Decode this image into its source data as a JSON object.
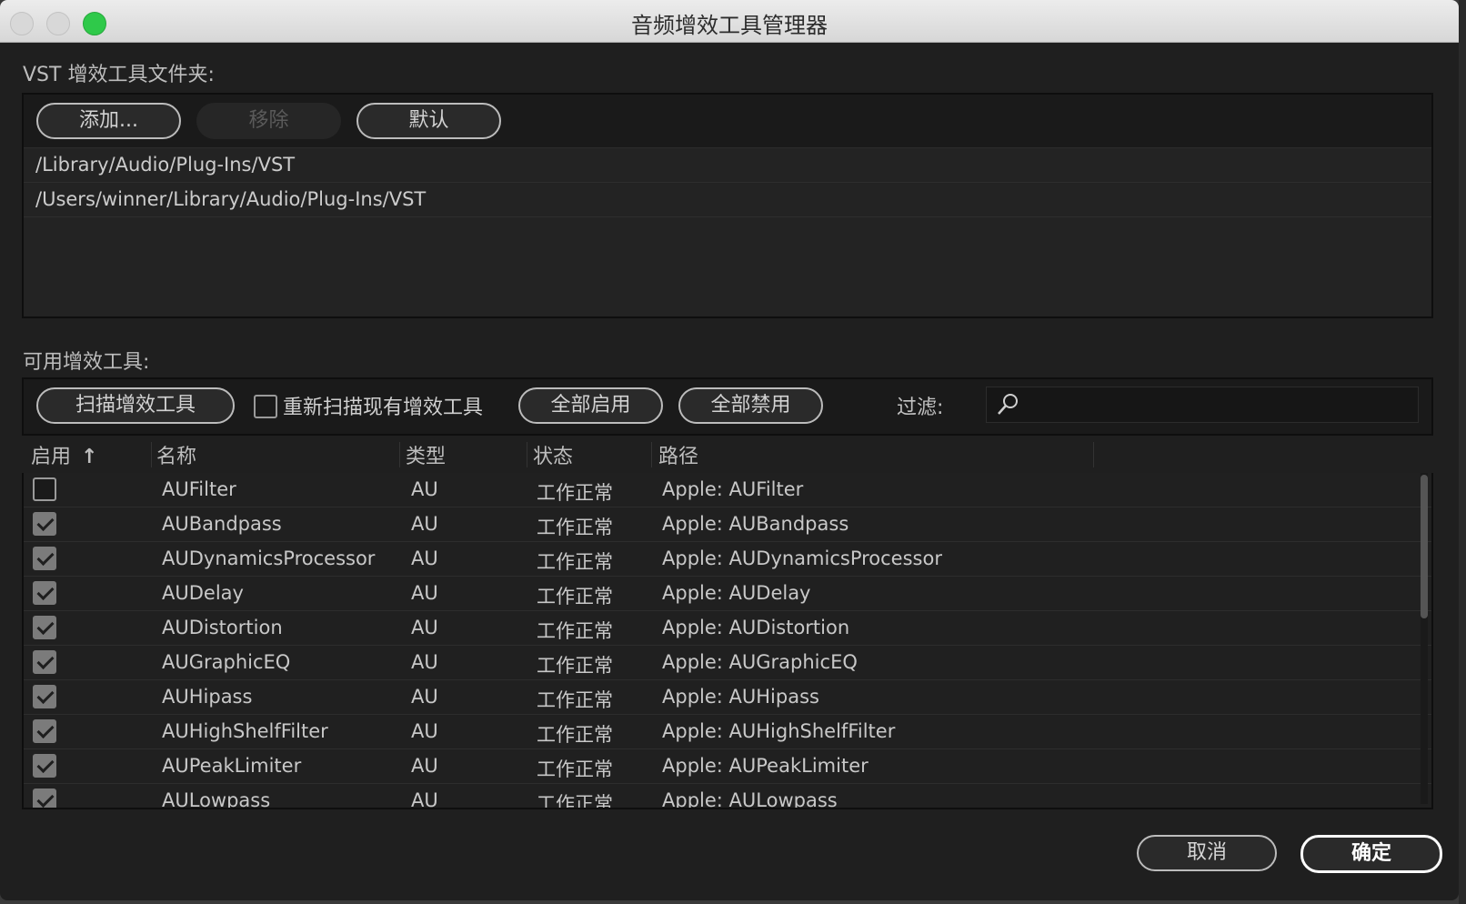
{
  "window": {
    "title": "音频增效工具管理器"
  },
  "vst": {
    "label": "VST 增效工具文件夹:",
    "buttons": {
      "add": "添加...",
      "remove": "移除",
      "default": "默认"
    },
    "paths": [
      "/Library/Audio/Plug-Ins/VST",
      "/Users/winner/Library/Audio/Plug-Ins/VST"
    ]
  },
  "available": {
    "label": "可用增效工具:",
    "scan_button": "扫描增效工具",
    "rescan_label": "重新扫描现有增效工具",
    "rescan_checked": false,
    "enable_all": "全部启用",
    "disable_all": "全部禁用",
    "filter_label": "过滤:",
    "filter_value": ""
  },
  "table": {
    "columns": {
      "enabled": "启用",
      "name": "名称",
      "type": "类型",
      "status": "状态",
      "path": "路径"
    },
    "sort_indicator": "↑",
    "rows": [
      {
        "enabled": false,
        "name": "AUFilter",
        "type": "AU",
        "status": "工作正常",
        "path": "Apple: AUFilter"
      },
      {
        "enabled": true,
        "name": "AUBandpass",
        "type": "AU",
        "status": "工作正常",
        "path": "Apple: AUBandpass"
      },
      {
        "enabled": true,
        "name": "AUDynamicsProcessor",
        "type": "AU",
        "status": "工作正常",
        "path": "Apple: AUDynamicsProcessor"
      },
      {
        "enabled": true,
        "name": "AUDelay",
        "type": "AU",
        "status": "工作正常",
        "path": "Apple: AUDelay"
      },
      {
        "enabled": true,
        "name": "AUDistortion",
        "type": "AU",
        "status": "工作正常",
        "path": "Apple: AUDistortion"
      },
      {
        "enabled": true,
        "name": "AUGraphicEQ",
        "type": "AU",
        "status": "工作正常",
        "path": "Apple: AUGraphicEQ"
      },
      {
        "enabled": true,
        "name": "AUHipass",
        "type": "AU",
        "status": "工作正常",
        "path": "Apple: AUHipass"
      },
      {
        "enabled": true,
        "name": "AUHighShelfFilter",
        "type": "AU",
        "status": "工作正常",
        "path": "Apple: AUHighShelfFilter"
      },
      {
        "enabled": true,
        "name": "AUPeakLimiter",
        "type": "AU",
        "status": "工作正常",
        "path": "Apple: AUPeakLimiter"
      },
      {
        "enabled": true,
        "name": "AULowpass",
        "type": "AU",
        "status": "工作正常",
        "path": "Apple: AULowpass"
      }
    ]
  },
  "footer": {
    "cancel": "取消",
    "ok": "确定"
  },
  "colors": {
    "window_bg": "#1f1f1f",
    "maximize_green": "#2fc94a"
  }
}
